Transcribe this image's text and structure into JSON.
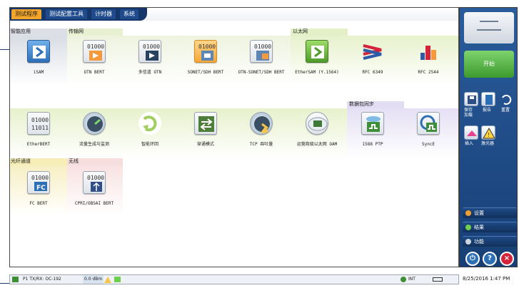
{
  "tabs": [
    {
      "label": "测试程序",
      "active": true
    },
    {
      "label": "测试配置工具",
      "active": false
    },
    {
      "label": "计时器",
      "active": false
    },
    {
      "label": "系统",
      "active": false
    }
  ],
  "categories": {
    "smart": "智能应用",
    "transport": "传输网",
    "ethernet": "以太网",
    "packet_sync": "数据包同步",
    "fiber": "光纤通道",
    "wireless": "无线"
  },
  "apps": [
    {
      "label": "iSAM",
      "icon": "isam-icon"
    },
    {
      "label": "OTN BERT",
      "icon": "otn-bert-icon"
    },
    {
      "label": "多信道 OTN",
      "icon": "multi-channel-otn-icon"
    },
    {
      "label": "SONET/SDH BERT",
      "icon": "sonet-sdh-bert-icon"
    },
    {
      "label": "OTN-SONET/SDH BERT",
      "icon": "otn-sonet-sdh-bert-icon"
    },
    {
      "label": "EtherSAM (Y.1564)",
      "icon": "ethersam-icon"
    },
    {
      "label": "RFC 6349",
      "icon": "rfc6349-icon"
    },
    {
      "label": "RFC 2544",
      "icon": "rfc2544-icon"
    },
    {
      "label": "EtherBERT",
      "icon": "etherbert-icon"
    },
    {
      "label": "流量生成与监测",
      "icon": "traffic-gen-icon"
    },
    {
      "label": "智能环回",
      "icon": "smart-loopback-icon"
    },
    {
      "label": "穿通模式",
      "icon": "through-mode-icon"
    },
    {
      "label": "TCP 吞吐量",
      "icon": "tcp-throughput-icon"
    },
    {
      "label": "运营商级以太网 OAM",
      "icon": "carrier-ethernet-oam-icon"
    },
    {
      "label": "1588 PTP",
      "icon": "ptp-1588-icon"
    },
    {
      "label": "SyncE",
      "icon": "synce-icon"
    },
    {
      "label": "FC BERT",
      "icon": "fc-bert-icon"
    },
    {
      "label": "CPRI/OBSAI BERT",
      "icon": "cpri-obsai-bert-icon"
    }
  ],
  "side": {
    "start": "开始",
    "save_load": "保存\n加载",
    "report": "报告",
    "reset": "重置",
    "insert": "插入",
    "laser": "激光器",
    "menu": [
      "设置",
      "结果",
      "功能"
    ]
  },
  "status": {
    "port": "P1 TX/RX: OC-192",
    "power": "0.0 dBm",
    "int": "INT",
    "datetime": "8/25/2016 1:47 PM"
  },
  "colors": {
    "tab_active": "#f4a62a",
    "tab_bar": "#14366b",
    "start": "#3d9a2e",
    "panel": "#1f4b8c"
  }
}
